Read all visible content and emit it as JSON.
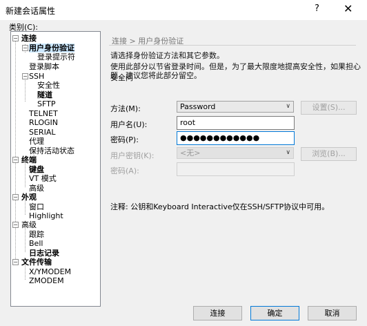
{
  "window": {
    "title": "新建会话属性",
    "help": "?",
    "close": "✕"
  },
  "category_label": "类别(C):",
  "tree": [
    {
      "label": "连接",
      "bold": true
    },
    {
      "label": "用户身份验证",
      "bold": true,
      "selected": true
    },
    {
      "label": "登录提示符"
    },
    {
      "label": "登录脚本"
    },
    {
      "label": "SSH"
    },
    {
      "label": "安全性"
    },
    {
      "label": "隧道",
      "bold": true
    },
    {
      "label": "SFTP"
    },
    {
      "label": "TELNET"
    },
    {
      "label": "RLOGIN"
    },
    {
      "label": "SERIAL"
    },
    {
      "label": "代理"
    },
    {
      "label": "保持活动状态"
    },
    {
      "label": "终端",
      "bold": true
    },
    {
      "label": "键盘",
      "bold": true
    },
    {
      "label": "VT 模式"
    },
    {
      "label": "高级"
    },
    {
      "label": "外观",
      "bold": true
    },
    {
      "label": "窗口"
    },
    {
      "label": "Highlight"
    },
    {
      "label": "高级"
    },
    {
      "label": "跟踪"
    },
    {
      "label": "Bell"
    },
    {
      "label": "日志记录",
      "bold": true
    },
    {
      "label": "文件传输",
      "bold": true
    },
    {
      "label": "X/YMODEM"
    },
    {
      "label": "ZMODEM"
    }
  ],
  "panel": {
    "header": "连接 > 用户身份验证",
    "desc1": "请选择身份验证方法和其它参数。",
    "desc2": "使用此部分以节省登录时间。但是，为了最大限度地提高安全性，如果担心安全问",
    "desc3": "题，建议您将此部分留空。",
    "method_label": "方法(M):",
    "method_value": "Password",
    "settings_button": "设置(S)...",
    "username_label": "用户名(U):",
    "username_value": "root",
    "password_label": "密码(P):",
    "password_value": "●●●●●●●●●●●●",
    "userkey_label": "用户密钥(K):",
    "userkey_value": "<无>",
    "browse_button": "浏览(B)...",
    "passphrase_label": "密码(A):",
    "note": "注释: 公钥和Keyboard Interactive仅在SSH/SFTP协议中可用。"
  },
  "buttons": {
    "connect": "连接",
    "ok": "确定",
    "cancel": "取消"
  }
}
